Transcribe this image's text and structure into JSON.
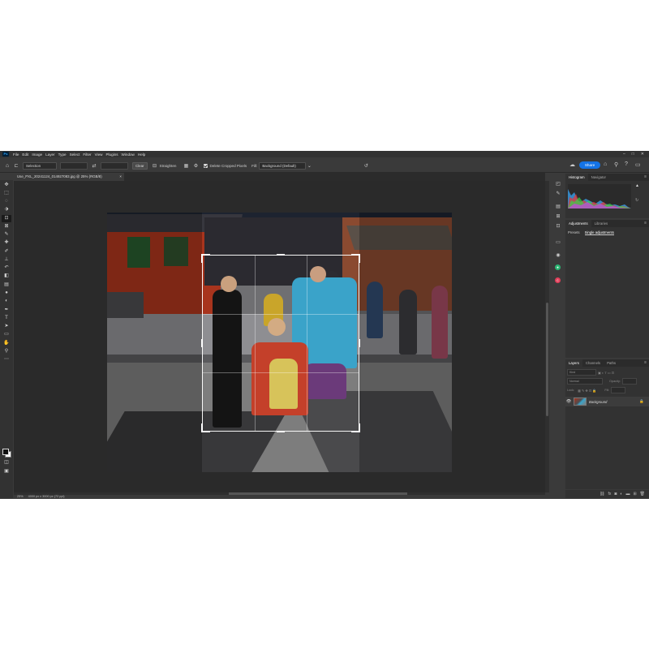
{
  "app": {
    "logo": "Ps",
    "menu": [
      "File",
      "Edit",
      "Image",
      "Layer",
      "Type",
      "Select",
      "Filter",
      "View",
      "Plugins",
      "Window",
      "Help"
    ],
    "window_controls": [
      "–",
      "□",
      "✕"
    ]
  },
  "options_bar": {
    "ratio_select": "Selection",
    "clear_label": "Clear",
    "straighten_label": "Straighten",
    "delete_cropped_label": "Delete Cropped Pixels",
    "delete_cropped_checked": true,
    "fill_label": "Fill:",
    "fill_select": "Background (Default)",
    "share_label": "Share"
  },
  "document": {
    "tab_title": "Use_PXL_20241124_014927083.jpg @ 25% (RGB/8)",
    "zoom": "25%",
    "dimensions": "4000 px x 3000 px (72 ppi)"
  },
  "panels": {
    "top_tabs": [
      "Histogram",
      "Navigator"
    ],
    "adjust_tabs": [
      "Adjustments",
      "Libraries"
    ],
    "adjust_subtabs": [
      "Presets",
      "Single adjustments"
    ],
    "layers_tabs": [
      "Layers",
      "Channels",
      "Paths"
    ],
    "layer_filter": "Kind",
    "blend_mode": "Normal",
    "opacity_label": "Opacity:",
    "lock_label": "Lock:",
    "fill_label": "Fill:",
    "layers": [
      {
        "name": "Background",
        "visible": true,
        "locked": true
      }
    ]
  },
  "colors": {
    "accent": "#1473e6",
    "foreground_swatch": "#111111",
    "background_swatch": "#ffffff"
  },
  "icons": {
    "tools": [
      "move-tool-icon",
      "marquee-tool-icon",
      "lasso-tool-icon",
      "object-select-tool-icon",
      "crop-tool-icon",
      "frame-tool-icon",
      "eyedropper-tool-icon",
      "spot-heal-tool-icon",
      "brush-tool-icon",
      "stamp-tool-icon",
      "history-brush-icon",
      "eraser-tool-icon",
      "gradient-tool-icon",
      "blur-tool-icon",
      "dodge-tool-icon",
      "pen-tool-icon",
      "type-tool-icon",
      "path-select-tool-icon",
      "shape-tool-icon",
      "hand-tool-icon",
      "zoom-tool-icon",
      "more-tools-icon"
    ]
  }
}
